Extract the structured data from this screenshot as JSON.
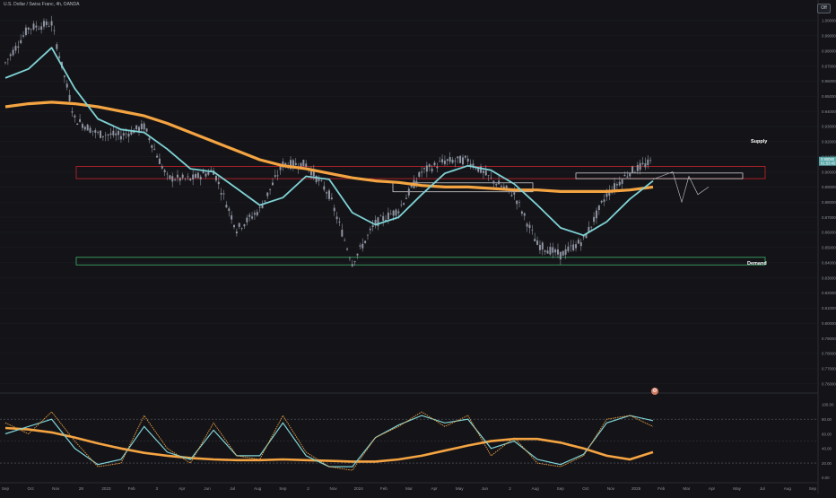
{
  "header": {
    "symbol_title": "U.S. Dollar / Swiss Franc, 4h, OANDA",
    "toggle_label": "Off"
  },
  "zones": {
    "supply_label": "Supply",
    "demand_label": "Demand"
  },
  "colors": {
    "background": "#141418",
    "candle": "#8e93a0",
    "fast_ma": "#7fd3d6",
    "slow_ma": "#f5a442",
    "supply_zone": "#c8242b",
    "demand_zone": "#3db36a",
    "box_white": "#e8e8e8",
    "osc_k": "#f5a442",
    "osc_d": "#7fd3d6",
    "signal_bull": "#3db36a",
    "signal_bear": "#f5a442"
  },
  "chart_data": [
    {
      "type": "line",
      "title": "U.S. Dollar / Swiss Franc, 4h, OANDA",
      "x_ticks": [
        "Sep",
        "Oct",
        "Nov",
        "28",
        "2023",
        "Feb",
        "3",
        "Apr",
        "Jun",
        "Jul",
        "Aug",
        "Sep",
        "2",
        "Nov",
        "2024",
        "Feb",
        "Mar",
        "Apr",
        "May",
        "Jun",
        "2",
        "Aug",
        "Sep",
        "Oct",
        "Nov",
        "2025",
        "Feb",
        "Mar",
        "Apr",
        "May",
        "Jul",
        "Aug",
        "Sep"
      ],
      "y_ticks": [
        "1.00000",
        "0.99000",
        "0.98000",
        "0.97000",
        "0.96000",
        "0.95000",
        "0.94000",
        "0.93000",
        "0.92000",
        "0.91000",
        "0.90000",
        "0.89000",
        "0.88000",
        "0.87000",
        "0.86000",
        "0.85000",
        "0.84000",
        "0.83000",
        "0.82000",
        "0.81000",
        "0.80000",
        "0.79000",
        "0.78000",
        "0.77000",
        "0.76000"
      ],
      "ylim": [
        0.755,
        1.01
      ],
      "price_label": "0.90080",
      "time_label": "01:53:45",
      "x": [
        "Sep 2022",
        "Oct 2022",
        "Nov 2022",
        "Dec 2022",
        "Jan 2023",
        "Feb 2023",
        "Mar 2023",
        "Apr 2023",
        "May 2023",
        "Jun 2023",
        "Jul 2023",
        "Aug 2023",
        "Sep 2023",
        "Oct 2023",
        "Nov 2023",
        "Dec 2023",
        "Jan 2024",
        "Feb 2024",
        "Mar 2024",
        "Apr 2024",
        "May 2024",
        "Jun 2024",
        "Jul 2024",
        "Aug 2024",
        "Sep 2024",
        "Oct 2024",
        "Nov 2024",
        "Dec 2024",
        "Jan 2025"
      ],
      "series": [
        {
          "values": [
            0.972,
            0.995,
            0.998,
            0.935,
            0.925,
            0.924,
            0.93,
            0.896,
            0.895,
            0.901,
            0.862,
            0.875,
            0.905,
            0.905,
            0.885,
            0.84,
            0.866,
            0.875,
            0.9,
            0.907,
            0.908,
            0.895,
            0.885,
            0.852,
            0.845,
            0.855,
            0.885,
            0.9,
            0.907
          ]
        },
        {
          "values": [
            0.962,
            0.968,
            0.982,
            0.955,
            0.935,
            0.928,
            0.926,
            0.915,
            0.902,
            0.9,
            0.889,
            0.878,
            0.883,
            0.897,
            0.895,
            0.873,
            0.865,
            0.87,
            0.885,
            0.899,
            0.904,
            0.901,
            0.892,
            0.878,
            0.863,
            0.858,
            0.867,
            0.882,
            0.894
          ]
        },
        {
          "values": [
            0.943,
            0.945,
            0.946,
            0.945,
            0.943,
            0.94,
            0.937,
            0.932,
            0.926,
            0.92,
            0.914,
            0.908,
            0.904,
            0.902,
            0.899,
            0.896,
            0.894,
            0.893,
            0.891,
            0.89,
            0.89,
            0.889,
            0.888,
            0.888,
            0.887,
            0.887,
            0.887,
            0.888,
            0.89
          ]
        }
      ],
      "zones": [
        {
          "label": "Supply",
          "from": 0.9035,
          "to": 0.8955
        },
        {
          "label": "Demand",
          "from": 0.8435,
          "to": 0.8385
        }
      ],
      "projection": [
        0.895,
        0.9,
        0.88,
        0.897,
        0.885,
        0.89
      ]
    },
    {
      "type": "line",
      "y_ticks": [
        "100.00",
        "80.00",
        "60.00",
        "40.00",
        "20.00",
        "0.00"
      ],
      "ylim": [
        -2,
        106
      ],
      "reference_lines": [
        80,
        20
      ],
      "x": [
        "Sep 2022",
        "Oct 2022",
        "Nov 2022",
        "Dec 2022",
        "Jan 2023",
        "Feb 2023",
        "Mar 2023",
        "Apr 2023",
        "May 2023",
        "Jun 2023",
        "Jul 2023",
        "Aug 2023",
        "Sep 2023",
        "Oct 2023",
        "Nov 2023",
        "Dec 2023",
        "Jan 2024",
        "Feb 2024",
        "Mar 2024",
        "Apr 2024",
        "May 2024",
        "Jun 2024",
        "Jul 2024",
        "Aug 2024",
        "Sep 2024",
        "Oct 2024",
        "Nov 2024",
        "Dec 2024",
        "Jan 2025"
      ],
      "series": [
        {
          "values": [
            75,
            60,
            90,
            50,
            15,
            20,
            85,
            40,
            20,
            75,
            30,
            25,
            85,
            35,
            15,
            10,
            55,
            70,
            90,
            70,
            85,
            30,
            55,
            20,
            15,
            30,
            80,
            85,
            70
          ]
        },
        {
          "values": [
            60,
            70,
            80,
            40,
            18,
            25,
            70,
            35,
            25,
            65,
            30,
            30,
            75,
            30,
            15,
            15,
            55,
            72,
            85,
            75,
            80,
            40,
            50,
            25,
            18,
            32,
            75,
            85,
            78
          ]
        },
        {
          "values": [
            68,
            66,
            62,
            55,
            47,
            40,
            34,
            30,
            27,
            25,
            24,
            24,
            25,
            24,
            23,
            22,
            22,
            25,
            30,
            37,
            44,
            50,
            53,
            53,
            48,
            40,
            30,
            25,
            35
          ]
        }
      ]
    }
  ]
}
